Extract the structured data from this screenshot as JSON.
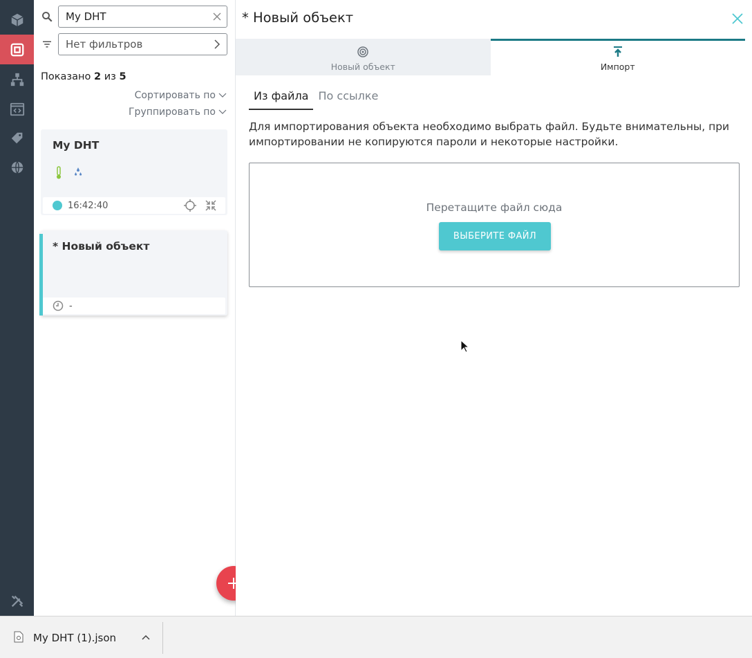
{
  "sidebar": {
    "icons": [
      "cube-icon",
      "device-icon",
      "hierarchy-icon",
      "code-icon",
      "tag-icon",
      "globe-icon",
      "tools-icon"
    ],
    "active_index": 1,
    "active_color": "#d9515a"
  },
  "list": {
    "search_value": "My DHT",
    "filter_value": "Нет фильтров",
    "shown_prefix": "Показано",
    "shown_count": "2",
    "shown_mid": "из",
    "shown_total": "5",
    "sort_label": "Сортировать по",
    "group_label": "Группировать по",
    "items": [
      {
        "title": "My DHT",
        "time": "16:42:40"
      },
      {
        "title": "* Новый объект",
        "time": "-"
      }
    ]
  },
  "main": {
    "title": "* Новый объект",
    "tabs": [
      {
        "label": "Новый объект"
      },
      {
        "label": "Импорт"
      }
    ],
    "subtabs": [
      {
        "label": "Из файла"
      },
      {
        "label": "По ссылке"
      }
    ],
    "description": "Для импортирования объекта необходимо выбрать файл. Будьте внимательны, при импортировании не копируются пароли и некоторые настройки.",
    "drop_text": "Перетащите файл сюда",
    "choose_button": "ВЫБЕРИТЕ ФАЙЛ",
    "accent_color": "#4fc8d0"
  },
  "download": {
    "file_name": "My DHT (1).json"
  }
}
